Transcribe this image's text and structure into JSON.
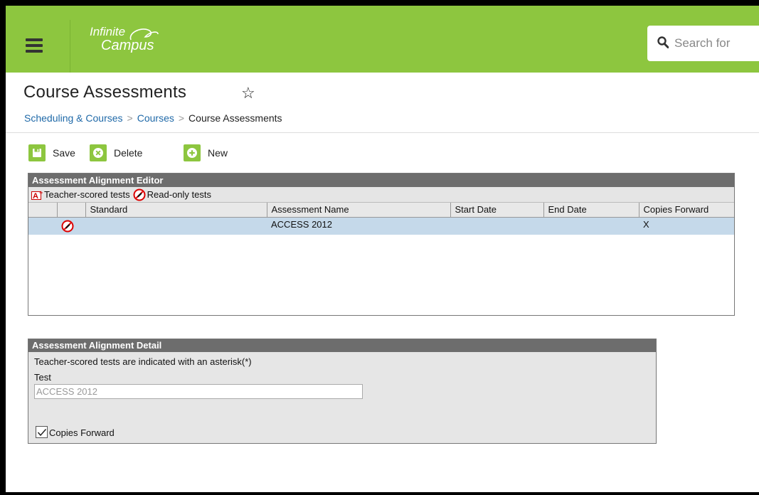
{
  "header": {
    "logo_line1": "Infinite",
    "logo_line2": "Campus",
    "search_placeholder": "Search for"
  },
  "page": {
    "title": "Course Assessments",
    "breadcrumb": [
      "Scheduling & Courses",
      "Courses",
      "Course Assessments"
    ]
  },
  "toolbar": {
    "save_label": "Save",
    "delete_label": "Delete",
    "new_label": "New"
  },
  "editor": {
    "title": "Assessment Alignment Editor",
    "legend_teacher": "Teacher-scored tests",
    "legend_readonly": "Read-only tests",
    "columns": [
      "Standard",
      "Assessment Name",
      "Start Date",
      "End Date",
      "Copies Forward"
    ],
    "rows": [
      {
        "standard": "",
        "assessment_name": "ACCESS 2012",
        "start_date": "",
        "end_date": "",
        "copies_forward": "X",
        "readonly": true
      }
    ]
  },
  "detail": {
    "title": "Assessment Alignment Detail",
    "note": "Teacher-scored tests are indicated with an asterisk(*)",
    "test_label": "Test",
    "test_value": "ACCESS 2012",
    "copies_forward_label": "Copies Forward",
    "copies_forward_checked": true
  },
  "colors": {
    "header_green": "#8dc63f",
    "link_blue": "#1f69a8",
    "panel_header": "#6d6d6d",
    "selected_row": "#c5d9ea"
  }
}
